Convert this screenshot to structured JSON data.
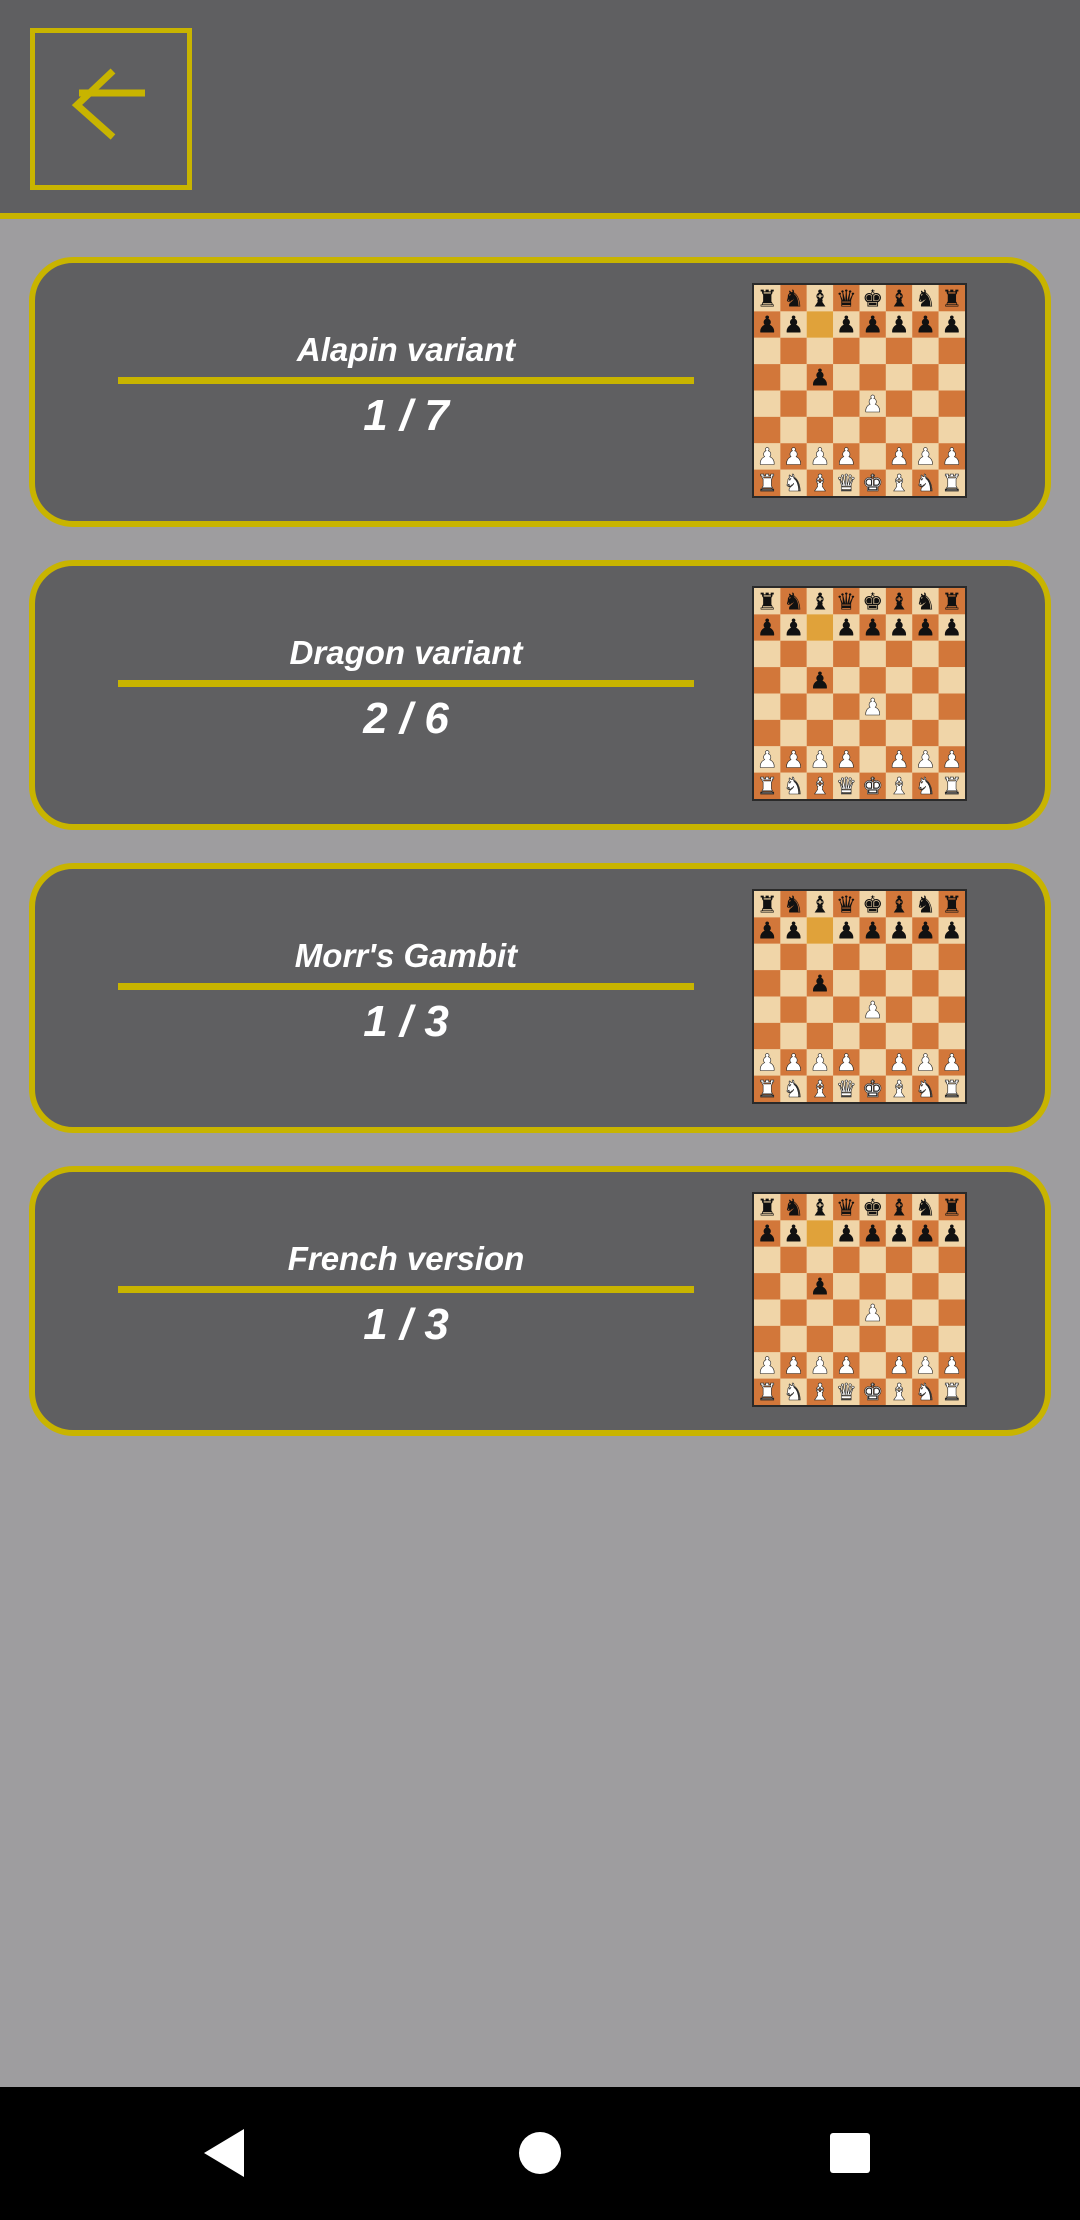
{
  "header": {
    "back_icon": "back-arrow-icon",
    "accent_color": "#c8b400"
  },
  "variants": [
    {
      "title": "Alapin variant",
      "progress": "1 / 7"
    },
    {
      "title": "Dragon variant",
      "progress": "2 / 6"
    },
    {
      "title": "Morr's Gambit",
      "progress": "1 / 3"
    },
    {
      "title": "French version",
      "progress": "1 / 3"
    }
  ],
  "board_preview": {
    "position": [
      "rnbqkbnr",
      "pp.ppppp",
      "........",
      "..p.....",
      "....P...",
      "........",
      "PPPP.PPP",
      "RNBQKBNR"
    ],
    "highlight_square": "c7",
    "light_square_color": "#f0d5a8",
    "dark_square_color": "#d2773a",
    "highlight_color": "#e0a23a"
  },
  "navbar": {
    "back_icon": "nav-back-icon",
    "home_icon": "nav-home-icon",
    "recents_icon": "nav-recents-icon"
  }
}
